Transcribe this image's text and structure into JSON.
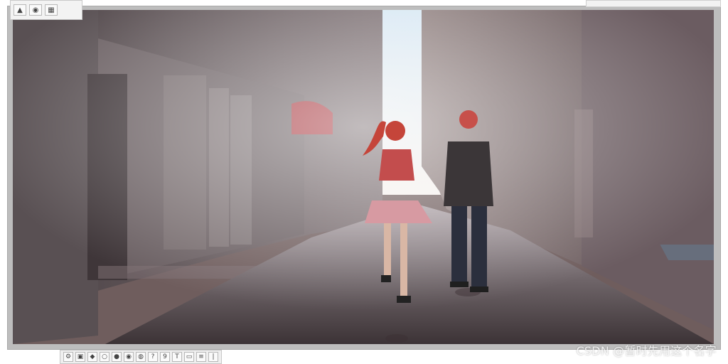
{
  "scene": {
    "palette": {
      "sky": "#f6f1ee",
      "left_building": "#6d6466",
      "right_building": "#7a6a6a",
      "street": "#5e5558",
      "shadow": "#3b2f33",
      "awning": "#a5333a",
      "girl_hair": "#c5453a",
      "girl_top": "#c34d4d",
      "girl_skirt": "#d79aa2",
      "man_jacket": "#3b3638",
      "man_pants": "#2b2f3d"
    }
  },
  "ui": {
    "toolbar_tl": {
      "icons": [
        "cursor-icon",
        "eye-icon",
        "grid-icon"
      ]
    },
    "toolbar_bottom": {
      "icons": [
        "settings-icon",
        "image-icon",
        "palette-icon",
        "circle-icon",
        "record-icon",
        "eye-icon",
        "camera-icon",
        "text-icon",
        "frame-icon",
        "layer-icon"
      ],
      "labels": [
        "?",
        "9",
        "|"
      ]
    }
  },
  "watermark": {
    "text": "CSDN @暂时先用这个名字"
  }
}
